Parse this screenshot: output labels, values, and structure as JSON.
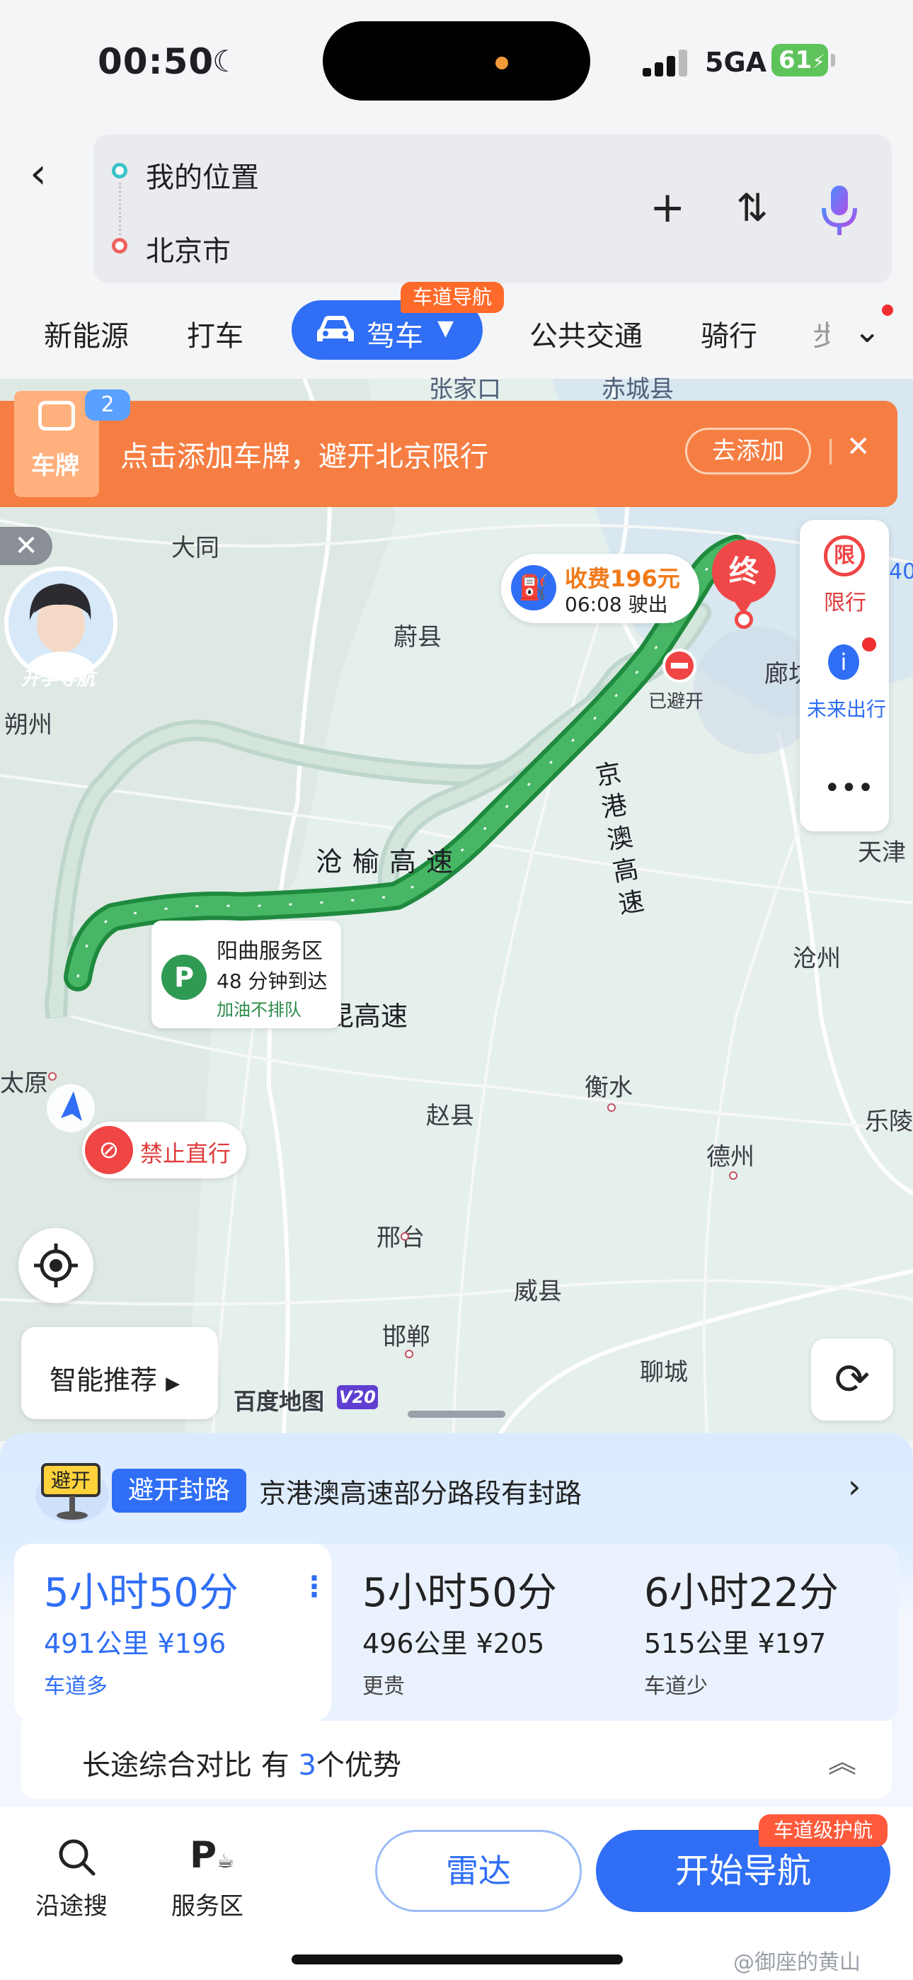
{
  "status_bar": {
    "time": "00:50",
    "network": "5GA",
    "battery": "61"
  },
  "route": {
    "start": "我的位置",
    "end": "北京市"
  },
  "modes": {
    "new_energy": "新能源",
    "taxi": "打车",
    "drive": "驾车",
    "drive_badge": "车道导航",
    "transit": "公共交通",
    "cycling": "骑行",
    "walk": "步"
  },
  "banner": {
    "icon_label": "车牌",
    "badge_count": "2",
    "text": "点击添加车牌，避开北京限行",
    "button": "去添加"
  },
  "map": {
    "avatar_label": "开学导航",
    "cities": {
      "zhangjiakou": "张家口",
      "chicheng": "赤城县",
      "datong": "大同",
      "yuxian": "蔚县",
      "shuozhou": "朔州",
      "langfang": "廊坊",
      "tianjin": "天津",
      "cangzhou": "沧州",
      "taiyuan": "太原",
      "hengshui": "衡水",
      "zhaoxian": "赵县",
      "leling": "乐陵",
      "dezhou": "德州",
      "xingtai": "邢台",
      "weixian": "威县",
      "handan": "邯郸",
      "liaocheng": "聊城"
    },
    "roads": {
      "jinggangao": "京港澳高速",
      "cangyu": "沧榆高速",
      "qingkun": "京昆高速"
    },
    "right_panel": {
      "limit_icon": "限",
      "limit": "限行",
      "future": "未来出行"
    },
    "toll": {
      "amount": "收费196元",
      "exit_time": "06:08 驶出"
    },
    "end_pin": "终",
    "passed_label": "已避开",
    "service": {
      "name": "阳曲服务区",
      "eta": "48 分钟到达",
      "note": "加油不排队"
    },
    "warning": "禁止直行",
    "smart_recommend": "智能推荐",
    "logo": "百度地图",
    "logo_version": "V20"
  },
  "avoid": {
    "icon_text": "避开",
    "tag": "避开封路",
    "text": "京港澳高速部分路段有封路"
  },
  "options": [
    {
      "time": "5小时50分",
      "info": "491公里 ¥196",
      "tag": "车道多"
    },
    {
      "time": "5小时50分",
      "info": "496公里 ¥205",
      "tag": "更贵"
    },
    {
      "time": "6小时22分",
      "info": "515公里 ¥197",
      "tag": "车道少"
    }
  ],
  "compare": {
    "prefix": "长途综合对比 有",
    "count": "3",
    "suffix": "个优势"
  },
  "bottom": {
    "search_along": "沿途搜",
    "service_area": "服务区",
    "radar": "雷达",
    "start_nav": "开始导航",
    "lane_guard": "车道级护航"
  },
  "watermark": "@御座的黄山",
  "colors": {
    "accent": "#2f6ef5",
    "route_green": "#3dae5c",
    "banner_orange": "#f67e43",
    "alert_red": "#f04545"
  }
}
